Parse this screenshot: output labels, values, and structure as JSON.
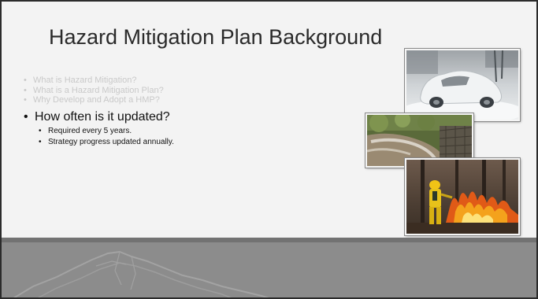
{
  "slide": {
    "title": "Hazard Mitigation Plan Background",
    "faded_bullets": [
      "What is Hazard Mitigation?",
      "What is a Hazard Mitigation Plan?",
      "Why Develop and Adopt a HMP?"
    ],
    "current_bullet": "How often is it updated?",
    "sub_bullets": [
      "Required every 5 years.",
      "Strategy progress updated annually."
    ],
    "bullet_glyph": "•"
  },
  "images": {
    "photo_1": "snow-covered-car-photo",
    "photo_2": "flooded-stream-photo",
    "photo_3": "wildfire-firefighter-photo"
  },
  "colors": {
    "slide_background": "#f3f3f3",
    "footer_band": "#8c8c8c",
    "faded_text": "#c9c9c9",
    "body_text": "#111111"
  }
}
